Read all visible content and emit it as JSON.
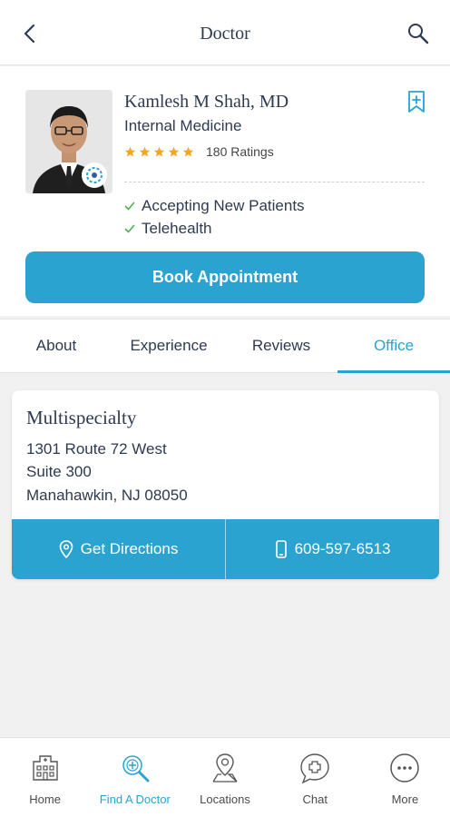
{
  "header": {
    "title": "Doctor",
    "back_icon": "back-chevron-icon",
    "search_icon": "search-icon"
  },
  "profile": {
    "name": "Kamlesh M Shah, MD",
    "specialty": "Internal Medicine",
    "stars": 5,
    "ratings_label": "180 Ratings",
    "features": [
      "Accepting New Patients",
      "Telehealth"
    ],
    "book_label": "Book Appointment",
    "bookmark_icon": "bookmark-plus-icon"
  },
  "tabs": [
    {
      "label": "About",
      "active": false
    },
    {
      "label": "Experience",
      "active": false
    },
    {
      "label": "Reviews",
      "active": false
    },
    {
      "label": "Office",
      "active": true
    }
  ],
  "office": {
    "name": "Multispecialty",
    "address_lines": [
      "1301 Route 72 West",
      "Suite 300",
      "Manahawkin, NJ 08050"
    ],
    "directions_label": "Get Directions",
    "phone": "609-597-6513"
  },
  "bottom_nav": [
    {
      "label": "Home",
      "icon": "hospital-icon",
      "active": false
    },
    {
      "label": "Find A Doctor",
      "icon": "find-doctor-icon",
      "active": true
    },
    {
      "label": "Locations",
      "icon": "location-pin-icon",
      "active": false
    },
    {
      "label": "Chat",
      "icon": "chat-icon",
      "active": false
    },
    {
      "label": "More",
      "icon": "more-icon",
      "active": false
    }
  ],
  "colors": {
    "accent": "#2aa3d1",
    "star": "#f5a623",
    "check": "#4caf50",
    "text": "#2e3a4f"
  }
}
